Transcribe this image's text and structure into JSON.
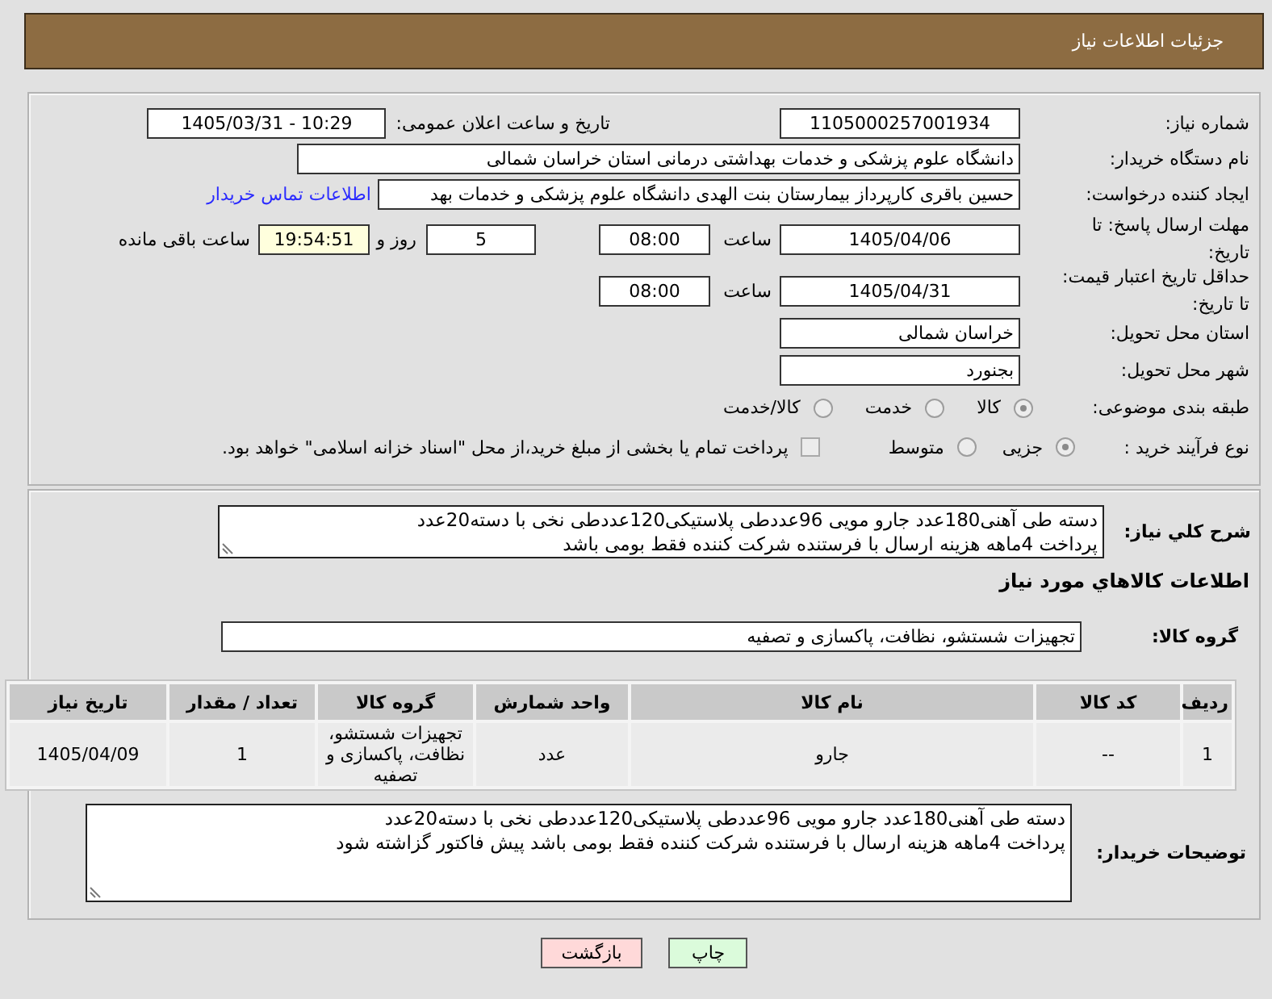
{
  "header": {
    "title": "جزئیات اطلاعات نیاز"
  },
  "details": {
    "need_number": {
      "label": "شماره نیاز:",
      "value": "1105000257001934"
    },
    "announcement": {
      "label": "تاریخ و ساعت اعلان عمومی:",
      "value": "1405/03/31 - 10:29"
    },
    "buyer_org": {
      "label": "نام دستگاه خریدار:",
      "value": "دانشگاه علوم پزشکی و خدمات بهداشتی درمانی استان خراسان شمالی"
    },
    "requester": {
      "label": "ایجاد کننده درخواست:",
      "value": "حسین باقری کارپرداز بیمارستان بنت الهدی دانشگاه علوم پزشکی و خدمات بهد",
      "contact_link": "اطلاعات تماس خریدار"
    },
    "response_deadline": {
      "label": "مهلت ارسال پاسخ: تا تاریخ:",
      "date": "1405/04/06",
      "time_label": "ساعت",
      "time": "08:00",
      "days": "5",
      "days_label": "روز و",
      "remaining": "19:54:51",
      "remaining_label": "ساعت باقی مانده"
    },
    "price_validity": {
      "label": "حداقل تاریخ اعتبار قیمت: تا تاریخ:",
      "date": "1405/04/31",
      "time_label": "ساعت",
      "time": "08:00"
    },
    "delivery_province": {
      "label": "استان محل تحویل:",
      "value": "خراسان شمالی"
    },
    "delivery_city": {
      "label": "شهر محل تحویل:",
      "value": "بجنورد"
    },
    "category": {
      "label": "طبقه بندی موضوعی:",
      "options": [
        {
          "label": "کالا",
          "selected": true
        },
        {
          "label": "خدمت",
          "selected": false
        },
        {
          "label": "کالا/خدمت",
          "selected": false
        }
      ]
    },
    "purchase_process": {
      "label": "نوع فرآیند خرید :",
      "options": [
        {
          "label": "جزیی",
          "selected": true
        },
        {
          "label": "متوسط",
          "selected": false
        }
      ],
      "treasury_payment": {
        "label": "پرداخت تمام یا بخشی از مبلغ خرید،از محل \"اسناد خزانه اسلامی\" خواهد بود.",
        "checked": false
      }
    }
  },
  "need": {
    "description": {
      "label": "شرح کلي نیاز:",
      "value": "دسته طی آهنی180عدد جارو مویی 96عددطی پلاستیکی120عددطی نخی با دسته20عدد\nپرداخت 4ماهه هزینه ارسال با فرستنده شرکت کننده فقط بومی باشد"
    },
    "goods_heading": "اطلاعات کالاهاي مورد نياز",
    "goods_group": {
      "label": "گروه کالا:",
      "value": "تجهیزات شستشو، نظافت، پاکسازی و تصفیه"
    },
    "table": {
      "columns": [
        "ردیف",
        "کد کالا",
        "نام کالا",
        "واحد شمارش",
        "گروه کالا",
        "تعداد / مقدار",
        "تاریخ نیاز"
      ],
      "rows": [
        [
          "1",
          "--",
          "جارو",
          "عدد",
          "تجهیزات شستشو، نظافت، پاکسازی و تصفیه",
          "1",
          "1405/04/09"
        ]
      ]
    },
    "buyer_notes": {
      "label": "توضیحات خریدار:",
      "value": "دسته طی آهنی180عدد جارو مویی 96عددطی پلاستیکی120عددطی نخی با دسته20عدد\nپرداخت 4ماهه هزینه ارسال با فرستنده شرکت کننده فقط بومی باشد پیش فاکتور گزاشته شود"
    }
  },
  "buttons": [
    {
      "label": "چاپ",
      "kind": "print"
    },
    {
      "label": "بازگشت",
      "kind": "back"
    }
  ]
}
